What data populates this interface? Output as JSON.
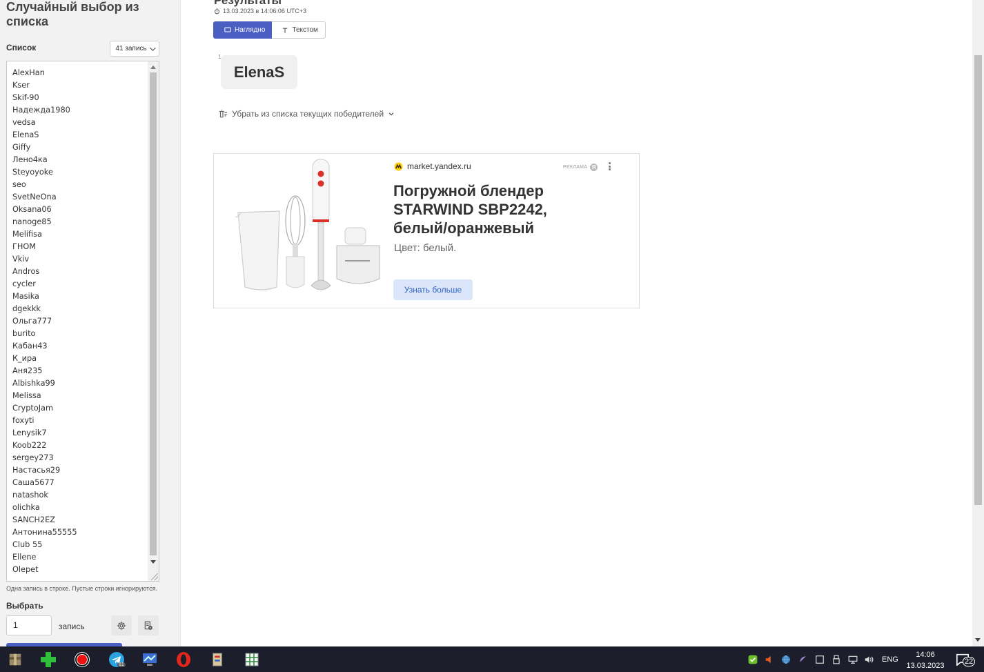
{
  "sidebar": {
    "app_title": "Случайный выбор из списка",
    "list_label": "Список",
    "count_selector": "41 запись",
    "items": [
      "AlexHan",
      "Kser",
      "Skif-90",
      "Надежда1980",
      "vedsa",
      "ElenaS",
      "Giffy",
      "Лено4ка",
      "Steyoyoke",
      "seo",
      "SvetNeOna",
      "Oksana06",
      "nanoge85",
      "Melifisa",
      "ГНОМ",
      "Vkiv",
      "Andros",
      "cycler",
      "Masika",
      "dgekkk",
      "Ольга777",
      "burito",
      "Кабан43",
      "К_ира",
      "Аня235",
      "Albishka99",
      "Melissa",
      "CryptoJam",
      "foxyti",
      "Lenysik7",
      "Koob222",
      "sergey273",
      "Настасья29",
      "Саша5677",
      "natashok",
      "olichka",
      "SANCH2EZ",
      "Антонина55555",
      "Club 55",
      "Ellene",
      "Olepet"
    ],
    "hint": "Одна запись в строке. Пустые строки игнорируются.",
    "choose_label": "Выбрать",
    "choose_value": "1",
    "choose_unit": "запись"
  },
  "main": {
    "results_title": "Результаты",
    "timestamp": "13.03.2023 в 14:06:06 UTC+3",
    "tabs": [
      {
        "label": "Наглядно",
        "icon": "monitor-icon",
        "active": true
      },
      {
        "label": "Текстом",
        "icon": "text-icon",
        "active": false
      }
    ],
    "winner": {
      "index": "1",
      "name": "ElenaS"
    },
    "remove_winners": "Убрать из списка текущих победителей"
  },
  "ad": {
    "domain": "market.yandex.ru",
    "label": "Реклама",
    "ya_glyph": "Я",
    "title": "Погружной блендер STARWIND SBP2242, белый/оранжевый",
    "subtitle": "Цвет: белый.",
    "button": "Узнать больше"
  },
  "taskbar": {
    "lang": "ENG",
    "time": "14:06",
    "date": "13.03.2023",
    "notifications": "22",
    "telegram_badge": "81"
  },
  "colors": {
    "accent": "#4a5fc1",
    "ad_button_bg": "#dbe6fb",
    "ad_button_text": "#2b5fc0",
    "taskbar": "#1c1f2b"
  }
}
